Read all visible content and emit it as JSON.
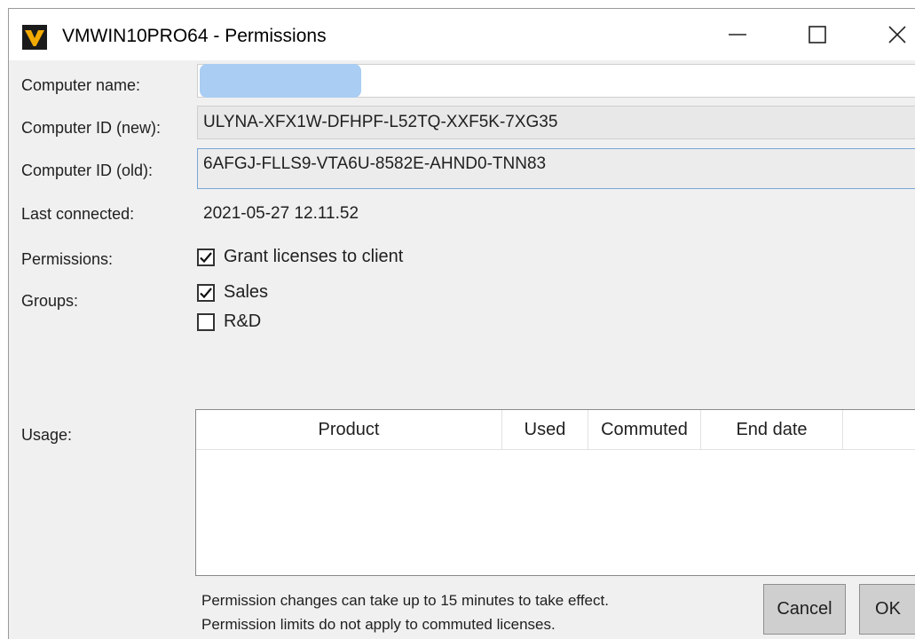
{
  "window": {
    "title": "VMWIN10PRO64 - Permissions"
  },
  "form": {
    "computer_name_label": "Computer name:",
    "computer_name_value": "",
    "computer_id_new_label": "Computer ID (new):",
    "computer_id_new_value": "ULYNA-XFX1W-DFHPF-L52TQ-XXF5K-7XG35",
    "computer_id_old_label": "Computer ID (old):",
    "computer_id_old_value": "6AFGJ-FLLS9-VTA6U-8582E-AHND0-TNN83",
    "last_connected_label": "Last connected:",
    "last_connected_value": "2021-05-27 12.11.52",
    "permissions_label": "Permissions:",
    "permissions_option": {
      "label": "Grant licenses to client",
      "checked": true
    },
    "groups_label": "Groups:",
    "groups": [
      {
        "label": "Sales",
        "checked": true
      },
      {
        "label": "R&D",
        "checked": false
      }
    ],
    "usage_label": "Usage:"
  },
  "usage_table": {
    "columns": [
      "Product",
      "Used",
      "Commuted",
      "End date"
    ],
    "rows": []
  },
  "notes": {
    "line1": "Permission changes can take up to 15 minutes to take effect.",
    "line2": "Permission limits do not apply to commuted licenses."
  },
  "buttons": {
    "cancel": "Cancel",
    "ok": "OK"
  },
  "colors": {
    "app_icon_bg": "#1b1b1b",
    "app_icon_accent": "#f2a900",
    "redaction": "#a9cdf3"
  }
}
